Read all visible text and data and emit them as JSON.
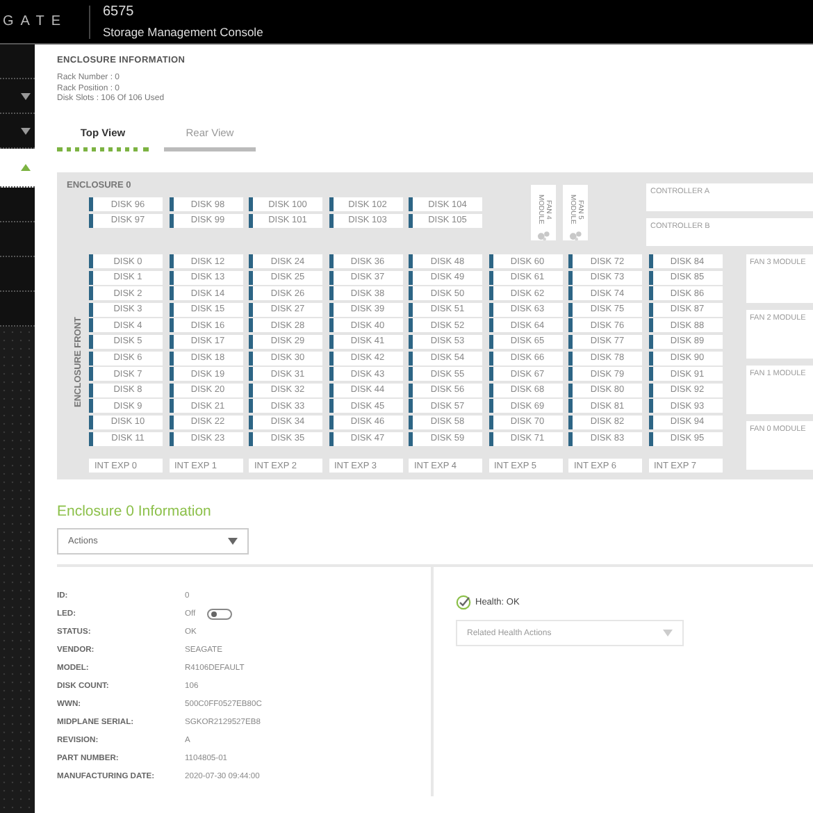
{
  "header": {
    "logo": "GATE",
    "model": "6575",
    "subtitle": "Storage Management Console"
  },
  "sidebar": {
    "items": [
      {
        "kind": "plain",
        "selected": false
      },
      {
        "kind": "group",
        "selected": false,
        "expanded": false
      },
      {
        "kind": "group",
        "selected": false,
        "expanded": false
      },
      {
        "kind": "group",
        "selected": true,
        "expanded": true
      },
      {
        "kind": "plain",
        "selected": false
      },
      {
        "kind": "plain",
        "selected": false
      },
      {
        "kind": "plain",
        "selected": false
      },
      {
        "kind": "plain",
        "selected": false
      }
    ]
  },
  "enclosure_information": {
    "title": "ENCLOSURE INFORMATION",
    "lines": [
      "Rack Number : 0",
      "Rack Position : 0",
      "Disk Slots : 106 Of 106 Used"
    ]
  },
  "tabs": [
    {
      "label": "Top View",
      "selected": true
    },
    {
      "label": "Rear View",
      "selected": false
    }
  ],
  "enclosure": {
    "title": "ENCLOSURE 0",
    "top_disks": [
      [
        "DISK 96",
        "DISK 97"
      ],
      [
        "DISK 98",
        "DISK 99"
      ],
      [
        "DISK 100",
        "DISK 101"
      ],
      [
        "DISK 102",
        "DISK 103"
      ],
      [
        "DISK 104",
        "DISK 105"
      ]
    ],
    "top_fans": [
      "FAN 4 MODULE",
      "FAN 5 MODULE"
    ],
    "controllers": [
      "CONTROLLER A",
      "CONTROLLER B"
    ],
    "front_label": "ENCLOSURE FRONT",
    "disk_columns": [
      [
        "DISK 0",
        "DISK 1",
        "DISK 2",
        "DISK 3",
        "DISK 4",
        "DISK 5",
        "DISK 6",
        "DISK 7",
        "DISK 8",
        "DISK 9",
        "DISK 10",
        "DISK 11"
      ],
      [
        "DISK 12",
        "DISK 13",
        "DISK 14",
        "DISK 15",
        "DISK 16",
        "DISK 17",
        "DISK 18",
        "DISK 19",
        "DISK 20",
        "DISK 21",
        "DISK 22",
        "DISK 23"
      ],
      [
        "DISK 24",
        "DISK 25",
        "DISK 26",
        "DISK 27",
        "DISK 28",
        "DISK 29",
        "DISK 30",
        "DISK 31",
        "DISK 32",
        "DISK 33",
        "DISK 34",
        "DISK 35"
      ],
      [
        "DISK 36",
        "DISK 37",
        "DISK 38",
        "DISK 39",
        "DISK 40",
        "DISK 41",
        "DISK 42",
        "DISK 43",
        "DISK 44",
        "DISK 45",
        "DISK 46",
        "DISK 47"
      ],
      [
        "DISK 48",
        "DISK 49",
        "DISK 50",
        "DISK 51",
        "DISK 52",
        "DISK 53",
        "DISK 54",
        "DISK 55",
        "DISK 56",
        "DISK 57",
        "DISK 58",
        "DISK 59"
      ],
      [
        "DISK 60",
        "DISK 61",
        "DISK 62",
        "DISK 63",
        "DISK 64",
        "DISK 65",
        "DISK 66",
        "DISK 67",
        "DISK 68",
        "DISK 69",
        "DISK 70",
        "DISK 71"
      ],
      [
        "DISK 72",
        "DISK 73",
        "DISK 74",
        "DISK 75",
        "DISK 76",
        "DISK 77",
        "DISK 78",
        "DISK 79",
        "DISK 80",
        "DISK 81",
        "DISK 82",
        "DISK 83"
      ],
      [
        "DISK 84",
        "DISK 85",
        "DISK 86",
        "DISK 87",
        "DISK 88",
        "DISK 89",
        "DISK 90",
        "DISK 91",
        "DISK 92",
        "DISK 93",
        "DISK 94",
        "DISK 95"
      ]
    ],
    "fan_modules": [
      "FAN 3 MODULE",
      "FAN 2 MODULE",
      "FAN 1 MODULE",
      "FAN 0 MODULE"
    ],
    "expanders": [
      "INT EXP 0",
      "INT EXP 1",
      "INT EXP 2",
      "INT EXP 3",
      "INT EXP 4",
      "INT EXP 5",
      "INT EXP 6",
      "INT EXP 7"
    ]
  },
  "details": {
    "title": "Enclosure 0 Information",
    "actions": {
      "value": "Actions"
    },
    "fields": [
      {
        "kind": "text",
        "label": "ID:",
        "value": "0"
      },
      {
        "kind": "toggle",
        "label": "LED:",
        "value": "Off",
        "on": false
      },
      {
        "kind": "text",
        "label": "STATUS:",
        "value": "OK"
      },
      {
        "kind": "text",
        "label": "VENDOR:",
        "value": "SEAGATE"
      },
      {
        "kind": "text",
        "label": "MODEL:",
        "value": "R4106DEFAULT"
      },
      {
        "kind": "text",
        "label": "DISK COUNT:",
        "value": "106"
      },
      {
        "kind": "text",
        "label": "WWN:",
        "value": "500C0FF0527EB80C"
      },
      {
        "kind": "text",
        "label": "MIDPLANE SERIAL:",
        "value": "SGKOR2129527EB8"
      },
      {
        "kind": "text",
        "label": "REVISION:",
        "value": "A"
      },
      {
        "kind": "text",
        "label": "PART NUMBER:",
        "value": "1104805-01"
      },
      {
        "kind": "text",
        "label": "MANUFACTURING DATE:",
        "value": "2020-07-30 09:44:00"
      }
    ]
  },
  "health": {
    "status": "Health: OK",
    "actions": {
      "placeholder": "Related Health Actions",
      "disabled": true
    }
  }
}
